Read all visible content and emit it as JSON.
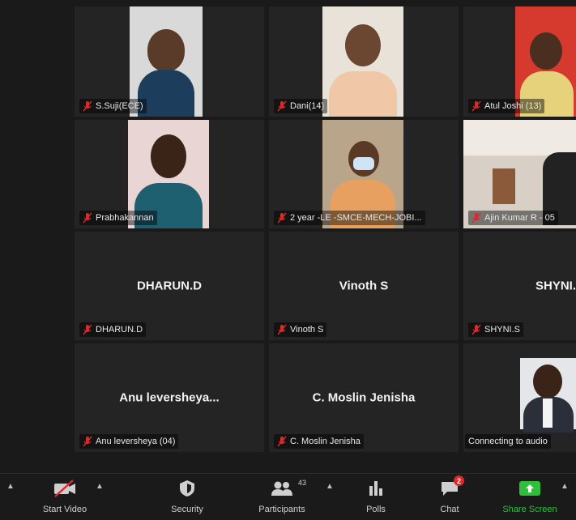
{
  "participants": [
    {
      "label": "S.Suji(ECE)",
      "display_name": ""
    },
    {
      "label": "Dani(14)",
      "display_name": ""
    },
    {
      "label": "Atul Joshi (13)",
      "display_name": ""
    },
    {
      "label": "Prabhakannan",
      "display_name": ""
    },
    {
      "label": "2 year -LE -SMCE-MECH-JOBI...",
      "display_name": ""
    },
    {
      "label": "Ajin Kumar R - 05",
      "display_name": ""
    },
    {
      "label": "DHARUN.D",
      "display_name": "DHARUN.D"
    },
    {
      "label": "Vinoth S",
      "display_name": "Vinoth S"
    },
    {
      "label": "SHYNI.S",
      "display_name": "SHYNI."
    },
    {
      "label": "Anu leversheya (04)",
      "display_name": "Anu leversheya..."
    },
    {
      "label": "C. Moslin Jenisha",
      "display_name": "C. Moslin Jenisha"
    },
    {
      "label": "Connecting to audio",
      "display_name": ""
    }
  ],
  "toolbar": {
    "start_video": "Start Video",
    "security": "Security",
    "participants": "Participants",
    "participants_count": "43",
    "polls": "Polls",
    "chat": "Chat",
    "chat_badge": "2",
    "share_screen": "Share Screen"
  },
  "colors": {
    "share_green": "#2fbf3a",
    "muted_red": "#e02828",
    "tile_bg": "#242424"
  }
}
